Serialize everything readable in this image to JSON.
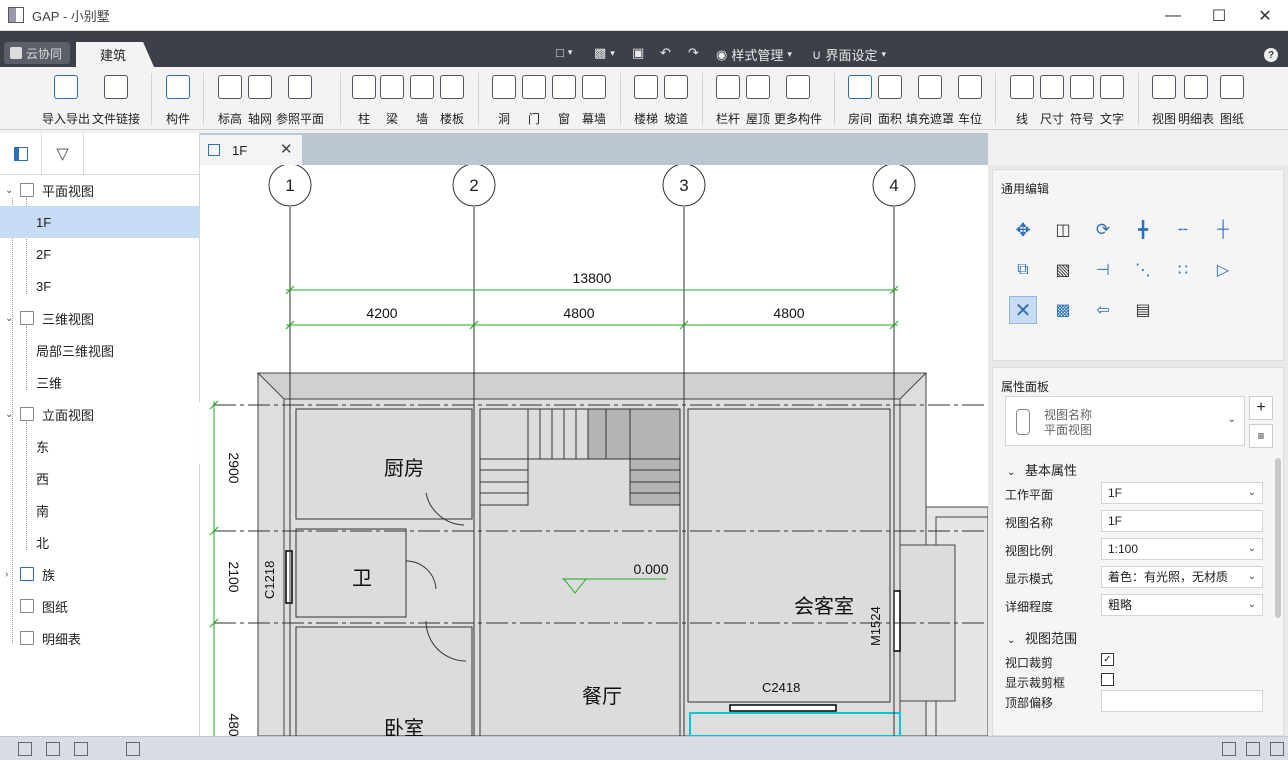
{
  "window": {
    "title": "GAP - 小别墅"
  },
  "menu": {
    "cloud_label": "云协同",
    "active_tab": "建筑",
    "style_manage": "样式管理",
    "ui_settings": "界面设定"
  },
  "ribbon": {
    "groups": [
      {
        "items": [
          "导入导出",
          "文件链接"
        ]
      },
      {
        "items": [
          "构件"
        ]
      },
      {
        "items": [
          "标高",
          "轴网",
          "参照平面"
        ]
      },
      {
        "items": [
          "柱",
          "梁",
          "墙",
          "楼板"
        ]
      },
      {
        "items": [
          "洞",
          "门",
          "窗",
          "幕墙"
        ]
      },
      {
        "items": [
          "楼梯",
          "坡道"
        ]
      },
      {
        "items": [
          "栏杆",
          "屋顶",
          "更多构件"
        ]
      },
      {
        "items": [
          "房间",
          "面积",
          "填充遮罩",
          "车位"
        ]
      },
      {
        "items": [
          "线",
          "尺寸",
          "符号",
          "文字"
        ]
      },
      {
        "items": [
          "视图",
          "明细表",
          "图纸"
        ]
      }
    ]
  },
  "tree": {
    "items": [
      {
        "label": "平面视图",
        "level": 0,
        "expanded": true
      },
      {
        "label": "1F",
        "level": 1,
        "selected": true
      },
      {
        "label": "2F",
        "level": 1
      },
      {
        "label": "3F",
        "level": 1
      },
      {
        "label": "三维视图",
        "level": 0,
        "expanded": true
      },
      {
        "label": "局部三维视图",
        "level": 1
      },
      {
        "label": "三维",
        "level": 1
      },
      {
        "label": "立面视图",
        "level": 0,
        "expanded": true
      },
      {
        "label": "东",
        "level": 1
      },
      {
        "label": "西",
        "level": 1
      },
      {
        "label": "南",
        "level": 1
      },
      {
        "label": "北",
        "level": 1
      },
      {
        "label": "族",
        "level": 0,
        "expanded": false
      },
      {
        "label": "图纸",
        "level": 0
      },
      {
        "label": "明细表",
        "level": 0
      }
    ]
  },
  "doc_tab": {
    "label": "1F"
  },
  "drawing": {
    "axes": [
      "1",
      "2",
      "3",
      "4"
    ],
    "dim_total": "13800",
    "dims_top": [
      "4200",
      "4800",
      "4800"
    ],
    "dims_left": [
      "2900",
      "2100",
      "480"
    ],
    "rooms": [
      "厨房",
      "卫",
      "会客室",
      "餐厅",
      "卧室"
    ],
    "elevation": "0.000",
    "windows": [
      "C1218",
      "M1524",
      "C2418"
    ]
  },
  "general_edit": {
    "title": "通用编辑",
    "icons": [
      "move-icon",
      "copy-icon",
      "rotate-icon",
      "trim-extend-icon",
      "split-icon",
      "align-icon",
      "offset-copy-icon",
      "extend-icon",
      "break-icon",
      "array-icon",
      "group-icon",
      "mirror-icon",
      "delete-icon",
      "section-box-icon",
      "attach-icon",
      "measure-icon"
    ]
  },
  "properties": {
    "title": "属性面板",
    "type_label": "视图名称",
    "type_value": "平面视图",
    "section_basic": "基本属性",
    "rows": [
      {
        "label": "工作平面",
        "value": "1F",
        "dropdown": true
      },
      {
        "label": "视图名称",
        "value": "1F",
        "dropdown": false
      },
      {
        "label": "视图比例",
        "value": "1:100",
        "dropdown": true
      },
      {
        "label": "显示模式",
        "value": "着色：有光照，无材质",
        "dropdown": true
      },
      {
        "label": "详细程度",
        "value": "粗略",
        "dropdown": true
      }
    ],
    "section_range": "视图范围",
    "checks": [
      {
        "label": "视口裁剪",
        "checked": true
      },
      {
        "label": "显示裁剪框",
        "checked": false
      }
    ],
    "cut_label": "顶部偏移"
  }
}
